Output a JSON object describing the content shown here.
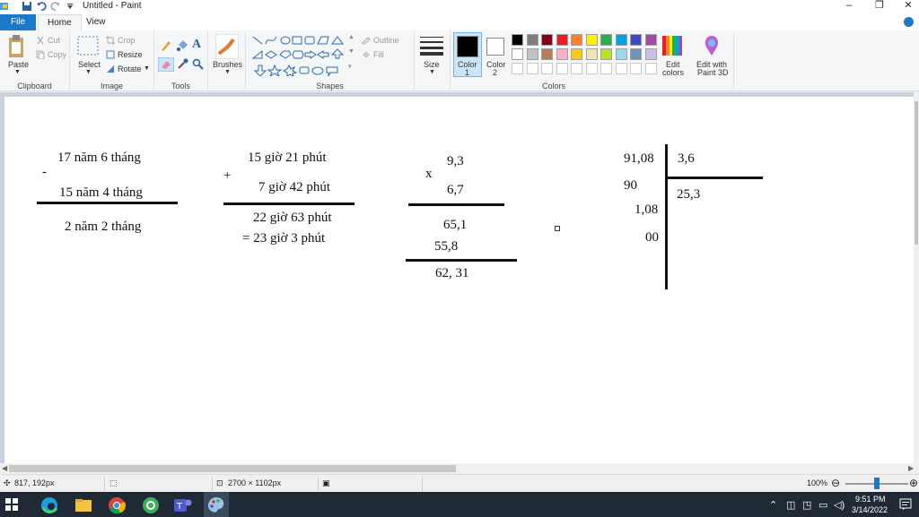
{
  "window": {
    "title": "Untitled - Paint",
    "minimize": "–",
    "maximize": "❐",
    "close": "✕"
  },
  "menu": {
    "file": "File",
    "home": "Home",
    "view": "View"
  },
  "ribbon": {
    "clipboard": {
      "label": "Clipboard",
      "paste": "Paste",
      "cut": "Cut",
      "copy": "Copy"
    },
    "image": {
      "label": "Image",
      "select": "Select",
      "crop": "Crop",
      "resize": "Resize",
      "rotate": "Rotate"
    },
    "tools": {
      "label": "Tools"
    },
    "brushes": {
      "label": "Brushes"
    },
    "shapes": {
      "label": "Shapes",
      "outline": "Outline",
      "fill": "Fill"
    },
    "size": {
      "label": "Size"
    },
    "colors": {
      "label": "Colors",
      "color1": "Color",
      "color1_num": "1",
      "color2": "Color",
      "color2_num": "2",
      "edit_colors_1": "Edit",
      "edit_colors_2": "colors",
      "edit_3d_1": "Edit with",
      "edit_3d_2": "Paint 3D",
      "color1_value": "#000000",
      "color2_value": "#ffffff",
      "palette_row1": [
        "#000000",
        "#7f7f7f",
        "#880015",
        "#ed1c24",
        "#ff7f27",
        "#fff200",
        "#22b14c",
        "#00a2e8",
        "#3f48cc",
        "#a349a4"
      ],
      "palette_row2": [
        "#ffffff",
        "#c3c3c3",
        "#b97a57",
        "#ffaec9",
        "#ffc90e",
        "#efe4b0",
        "#b5e61d",
        "#99d9ea",
        "#7092be",
        "#c8bfe7"
      ]
    }
  },
  "canvas": {
    "sub": {
      "top": "17 năm 6 tháng",
      "op": "-",
      "bottom": "15 năm 4 tháng",
      "result": "2 năm 2 tháng"
    },
    "add": {
      "top": "15 giờ 21 phút",
      "op": "+",
      "bottom": "7 giờ 42 phút",
      "result": "22 giờ 63 phút",
      "result2": "= 23 giờ 3 phút"
    },
    "mul": {
      "top": "9,3",
      "op": "x",
      "bottom": "6,7",
      "p1": "65,1",
      "p2": "55,8",
      "result": "62, 31"
    },
    "div": {
      "dividend": "91,08",
      "divisor": "3,6",
      "r1": "90",
      "quotient": "25,3",
      "r2": "1,08",
      "r3": "00"
    }
  },
  "status": {
    "cursor": "817, 192px",
    "size": "2700 × 1102px",
    "zoom": "100%",
    "zoom_minus": "⊖",
    "zoom_plus": "⊕"
  },
  "taskbar": {
    "time": "9:51 PM",
    "date": "3/14/2022"
  }
}
